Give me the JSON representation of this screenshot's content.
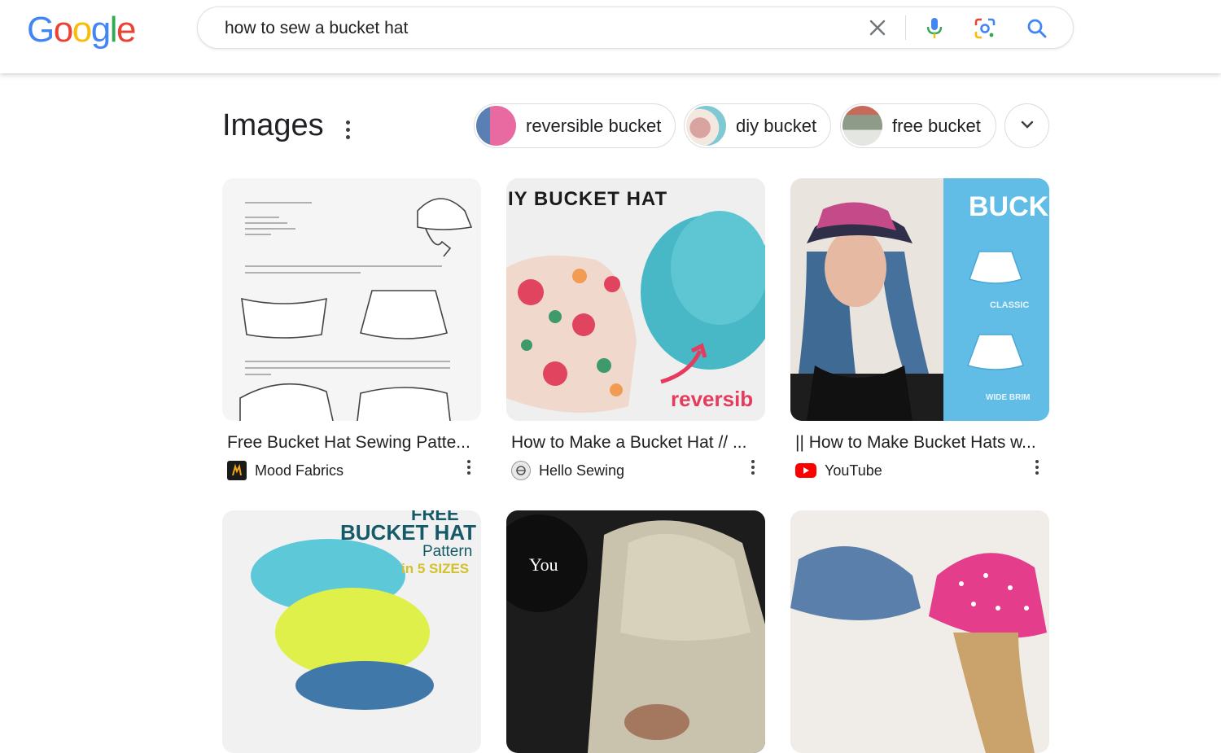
{
  "logo": {
    "text": "Google",
    "letters": [
      "G",
      "o",
      "o",
      "g",
      "l",
      "e"
    ],
    "colors": [
      "#4285F4",
      "#EA4335",
      "#FBBC05",
      "#4285F4",
      "#34A853",
      "#EA4335"
    ]
  },
  "search": {
    "query": "how to sew a bucket hat",
    "clear_icon": "close-icon",
    "voice_icon": "mic-icon",
    "lens_icon": "lens-icon",
    "search_icon": "search-icon"
  },
  "images_section": {
    "title": "Images",
    "chips": [
      {
        "label": "reversible bucket"
      },
      {
        "label": "diy bucket"
      },
      {
        "label": "free bucket"
      }
    ],
    "expand_icon": "chevron-down-icon"
  },
  "results": [
    {
      "title": "Free Bucket Hat Sewing Patte...",
      "source": "Mood Fabrics",
      "favicon": "mood-fabrics-icon"
    },
    {
      "title": "How to Make a Bucket Hat // ...",
      "source": "Hello Sewing",
      "favicon": "hello-sewing-icon",
      "image_text": [
        "IY BUCKET HAT",
        "reversib"
      ]
    },
    {
      "title": "|| How to Make Bucket Hats w...",
      "source": "YouTube",
      "favicon": "youtube-icon",
      "image_text": [
        "BUCKE",
        "CLASSIC",
        "WIDE BRIM"
      ]
    },
    {
      "title": "",
      "source": "",
      "image_text": [
        "FREE",
        "BUCKET HAT",
        "Pattern",
        "in 5 SIZES"
      ]
    },
    {
      "title": "",
      "source": "",
      "image_text": [
        "You"
      ]
    },
    {
      "title": "",
      "source": ""
    }
  ],
  "colors": {
    "accent_blue": "#4285F4",
    "youtube_red": "#FF0000",
    "text": "#202124"
  }
}
